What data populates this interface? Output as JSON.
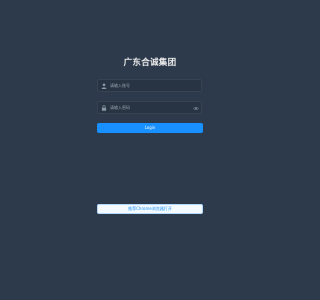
{
  "page": {
    "title": "广东合诚集团",
    "background_color": "#2d3a4b"
  },
  "form": {
    "username": {
      "icon": "user-icon",
      "placeholder": "请输入账号",
      "value": ""
    },
    "password": {
      "icon": "lock-icon",
      "placeholder": "请输入密码",
      "value": "",
      "toggle_icon": "eye-icon"
    },
    "login_label": "Login",
    "login_color": "#1890ff"
  },
  "download": {
    "label": "推荐Chrome浏览器打开"
  }
}
